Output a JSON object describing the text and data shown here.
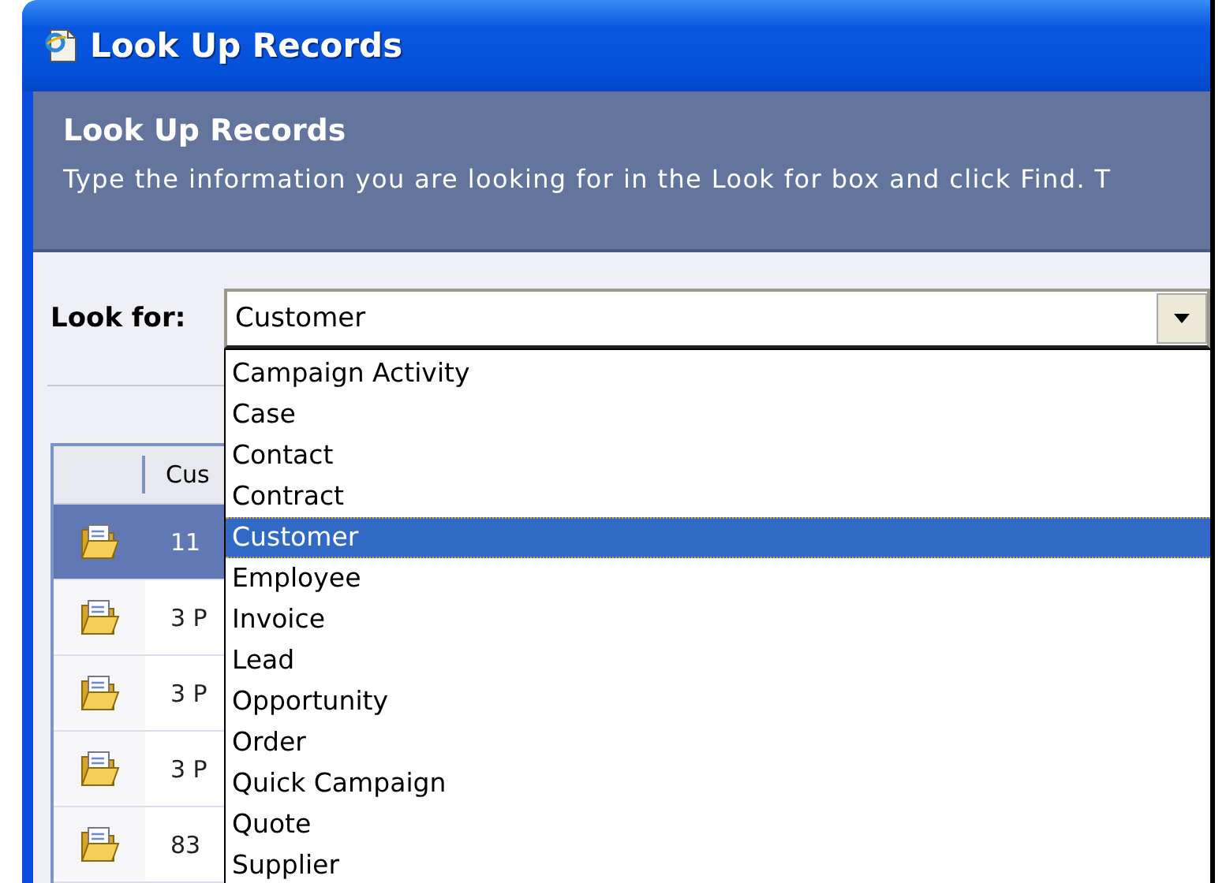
{
  "window": {
    "title": "Look Up Records"
  },
  "header": {
    "title": "Look Up Records",
    "description": "Type the information you are looking for in the Look for box and click Find. T"
  },
  "look_for": {
    "label": "Look for:",
    "value": "Customer",
    "expanded": true,
    "options": [
      {
        "label": "Campaign Activity",
        "selected": false
      },
      {
        "label": "Case",
        "selected": false
      },
      {
        "label": "Contact",
        "selected": false
      },
      {
        "label": "Contract",
        "selected": false
      },
      {
        "label": "Customer",
        "selected": true
      },
      {
        "label": "Employee",
        "selected": false
      },
      {
        "label": "Invoice",
        "selected": false
      },
      {
        "label": "Lead",
        "selected": false
      },
      {
        "label": "Opportunity",
        "selected": false
      },
      {
        "label": "Order",
        "selected": false
      },
      {
        "label": "Quick Campaign",
        "selected": false
      },
      {
        "label": "Quote",
        "selected": false
      },
      {
        "label": "Supplier",
        "selected": false
      }
    ]
  },
  "grid": {
    "columns": [
      "Cus"
    ],
    "rows": [
      {
        "cell": "11",
        "selected": true
      },
      {
        "cell": "3 P",
        "selected": false
      },
      {
        "cell": "3 P",
        "selected": false
      },
      {
        "cell": "3 P",
        "selected": false
      },
      {
        "cell": "83",
        "selected": false
      }
    ]
  }
}
